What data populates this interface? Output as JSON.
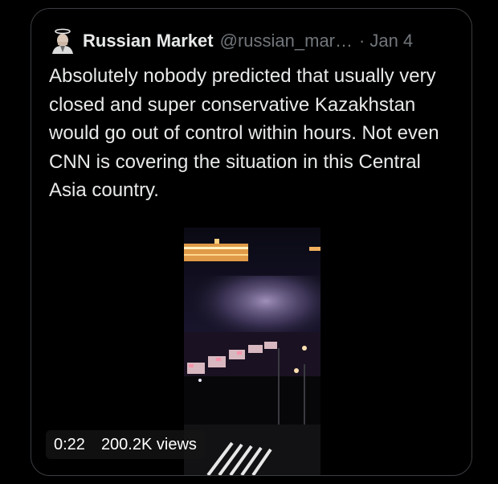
{
  "tweet": {
    "display_name": "Russian Market",
    "handle": "@russian_mar…",
    "separator": "·",
    "date": "Jan 4",
    "text": "Absolutely nobody predicted that usually very closed and super conservative Kazakhstan would go out of control within hours. Not even CNN is covering the situation in this Central Asia country.",
    "avatar_icon": "avatar-halo-portrait-icon"
  },
  "video": {
    "duration": "0:22",
    "views": "200.2K views"
  }
}
